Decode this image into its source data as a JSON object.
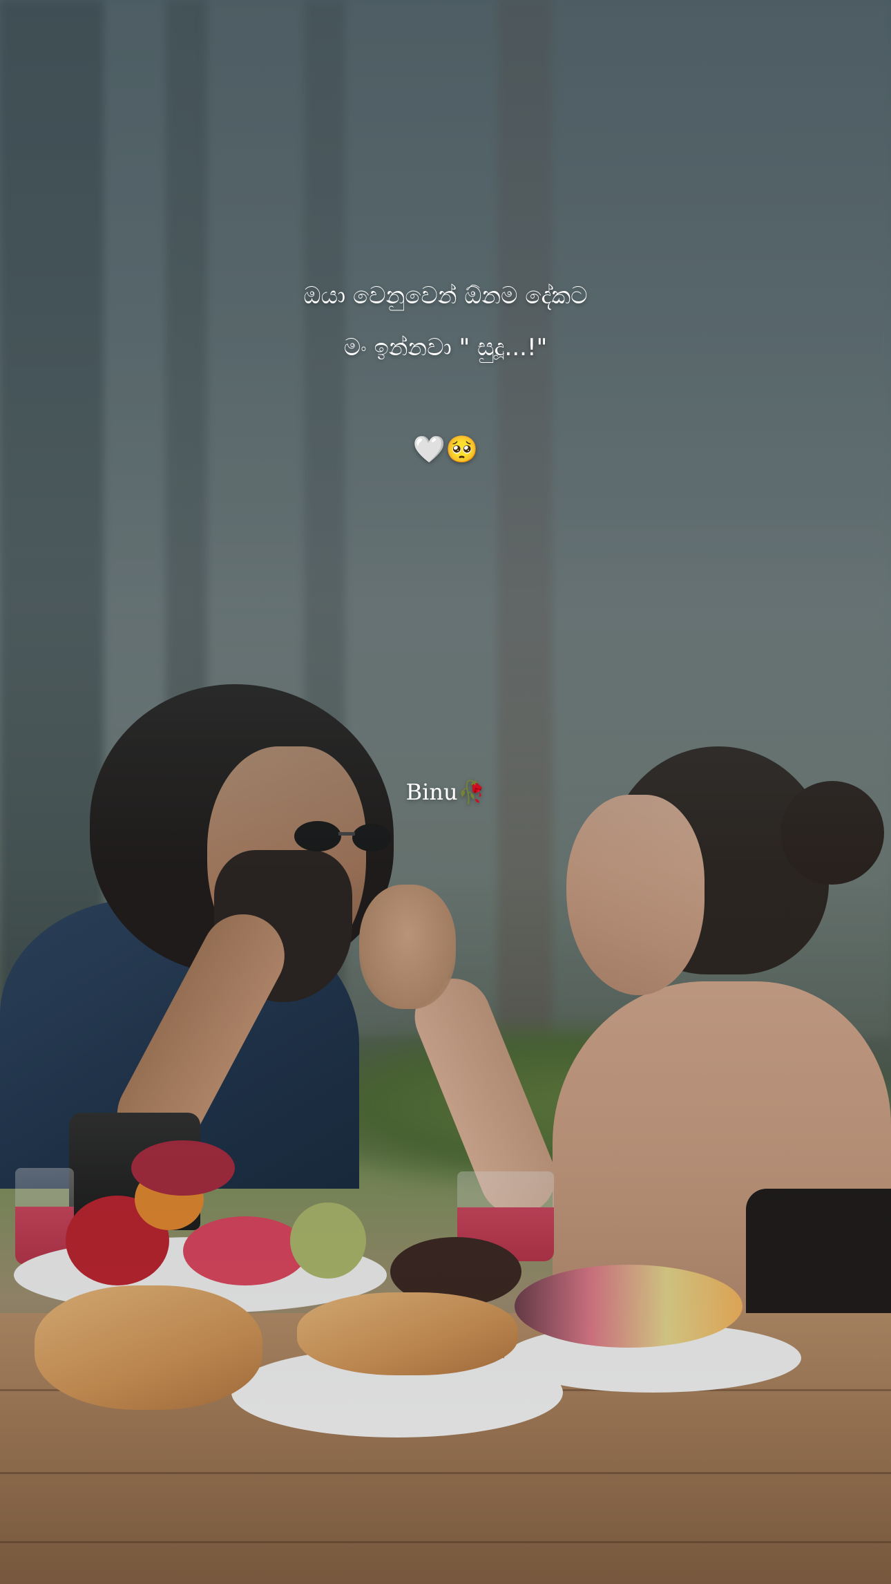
{
  "caption": {
    "line1": "ඔයා වෙනුවෙන් ඕනම දේකට",
    "line2": "මං ඉන්නවා \" සුදූ...!\"",
    "emojis": "🤍🥺"
  },
  "signature": {
    "name": "Binu",
    "emoji": "🥀"
  },
  "colors": {
    "text": "#ffffff",
    "overlay": "#3c4b50"
  }
}
